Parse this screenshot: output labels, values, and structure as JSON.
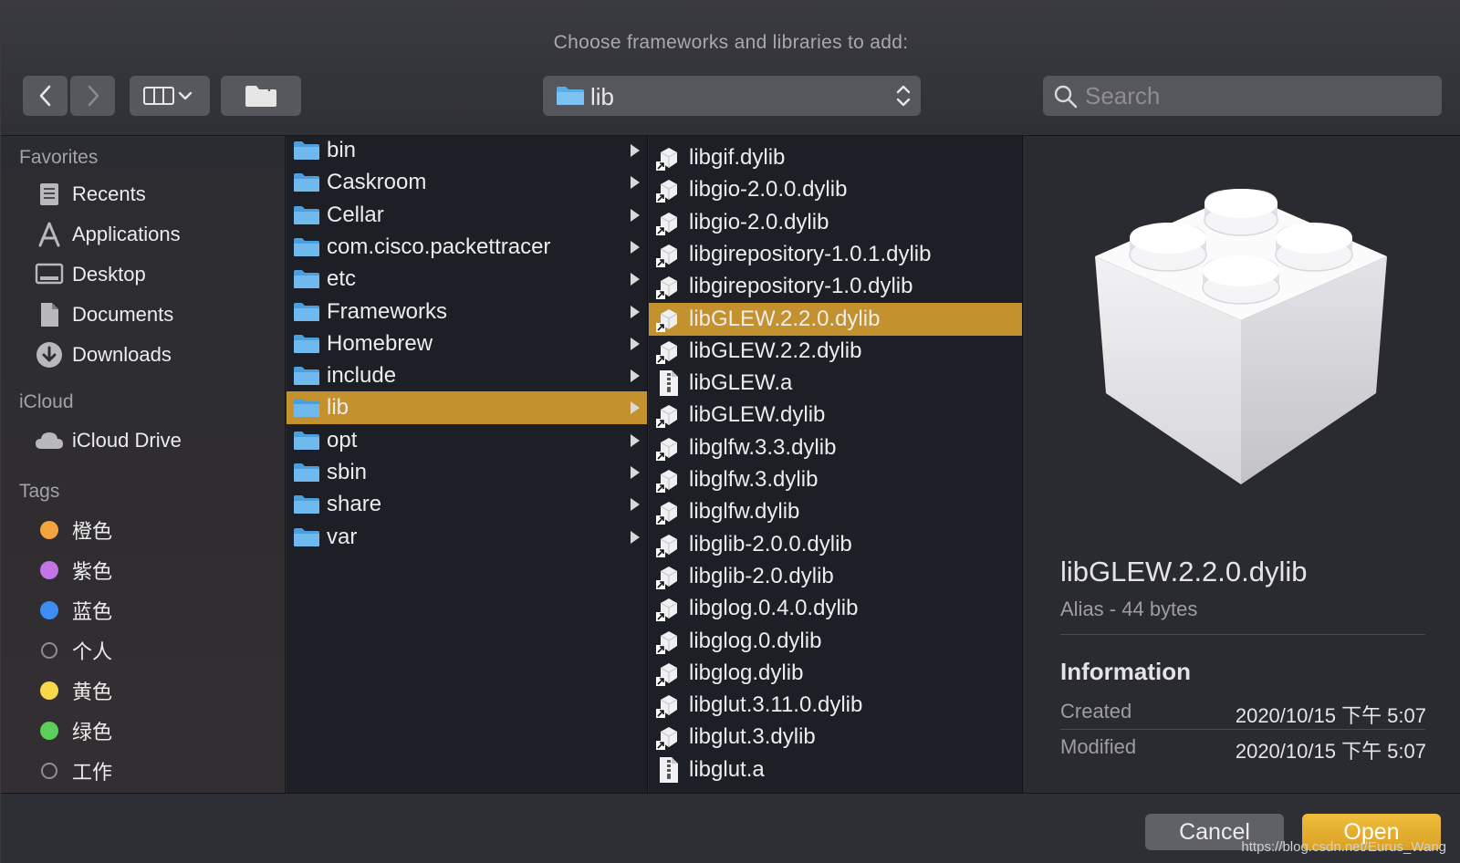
{
  "dialog": {
    "title": "Choose frameworks and libraries to add:"
  },
  "toolbar": {
    "back_icon": "chevron-left-icon",
    "forward_icon": "chevron-right-icon",
    "view_icon": "column-view-icon",
    "new_folder_icon": "new-folder-icon",
    "path_label": "lib",
    "search_placeholder": "Search"
  },
  "sidebar": {
    "favorites_header": "Favorites",
    "favorites": [
      {
        "label": "Recents",
        "icon": "recents-icon"
      },
      {
        "label": "Applications",
        "icon": "applications-icon"
      },
      {
        "label": "Desktop",
        "icon": "desktop-icon"
      },
      {
        "label": "Documents",
        "icon": "documents-icon"
      },
      {
        "label": "Downloads",
        "icon": "downloads-icon"
      }
    ],
    "icloud_header": "iCloud",
    "icloud": [
      {
        "label": "iCloud Drive",
        "icon": "cloud-icon"
      }
    ],
    "tags_header": "Tags",
    "tags": [
      {
        "label": "橙色",
        "color": "#f5a33c"
      },
      {
        "label": "紫色",
        "color": "#c375e8"
      },
      {
        "label": "蓝色",
        "color": "#3d8ef2"
      },
      {
        "label": "个人",
        "color": ""
      },
      {
        "label": "黄色",
        "color": "#f7d84a"
      },
      {
        "label": "绿色",
        "color": "#5ad05a"
      },
      {
        "label": "工作",
        "color": ""
      }
    ]
  },
  "column1": {
    "items": [
      {
        "label": "bin"
      },
      {
        "label": "Caskroom"
      },
      {
        "label": "Cellar"
      },
      {
        "label": "com.cisco.packettracer"
      },
      {
        "label": "etc"
      },
      {
        "label": "Frameworks"
      },
      {
        "label": "Homebrew"
      },
      {
        "label": "include"
      },
      {
        "label": "lib",
        "selected": true
      },
      {
        "label": "opt"
      },
      {
        "label": "sbin"
      },
      {
        "label": "share"
      },
      {
        "label": "var"
      }
    ]
  },
  "column2": {
    "items": [
      {
        "label": "libgif.dylib",
        "kind": "alias"
      },
      {
        "label": "libgio-2.0.0.dylib",
        "kind": "alias"
      },
      {
        "label": "libgio-2.0.dylib",
        "kind": "alias"
      },
      {
        "label": "libgirepository-1.0.1.dylib",
        "kind": "alias"
      },
      {
        "label": "libgirepository-1.0.dylib",
        "kind": "alias"
      },
      {
        "label": "libGLEW.2.2.0.dylib",
        "kind": "alias",
        "selected": true
      },
      {
        "label": "libGLEW.2.2.dylib",
        "kind": "alias"
      },
      {
        "label": "libGLEW.a",
        "kind": "archive"
      },
      {
        "label": "libGLEW.dylib",
        "kind": "alias"
      },
      {
        "label": "libglfw.3.3.dylib",
        "kind": "alias"
      },
      {
        "label": "libglfw.3.dylib",
        "kind": "alias"
      },
      {
        "label": "libglfw.dylib",
        "kind": "alias"
      },
      {
        "label": "libglib-2.0.0.dylib",
        "kind": "alias"
      },
      {
        "label": "libglib-2.0.dylib",
        "kind": "alias"
      },
      {
        "label": "libglog.0.4.0.dylib",
        "kind": "alias"
      },
      {
        "label": "libglog.0.dylib",
        "kind": "alias"
      },
      {
        "label": "libglog.dylib",
        "kind": "alias"
      },
      {
        "label": "libglut.3.11.0.dylib",
        "kind": "alias"
      },
      {
        "label": "libglut.3.dylib",
        "kind": "alias"
      },
      {
        "label": "libglut.a",
        "kind": "archive"
      }
    ]
  },
  "preview": {
    "name": "libGLEW.2.2.0.dylib",
    "kind": "Alias - 44 bytes",
    "info_header": "Information",
    "created_label": "Created",
    "created_value": "2020/10/15 下午 5:07",
    "modified_label": "Modified",
    "modified_value": "2020/10/15 下午 5:07"
  },
  "buttons": {
    "cancel": "Cancel",
    "open": "Open"
  },
  "watermark": "https://blog.csdn.net/Eurus_Wang",
  "colors": {
    "selection": "#c3922f",
    "folder_blue": "#5aaee8",
    "open_button": "#e8b030"
  }
}
